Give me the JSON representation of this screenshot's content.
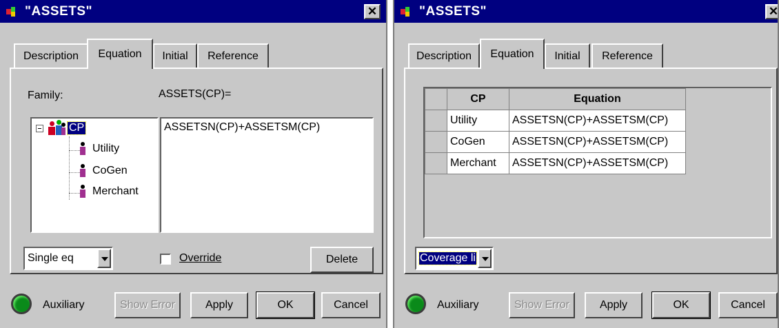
{
  "dialogs": [
    {
      "title": "\"ASSETS\"",
      "tabs": [
        "Description",
        "Equation",
        "Initial",
        "Reference"
      ],
      "active_tab": "Equation",
      "family_label": "Family:",
      "equation_label": "ASSETS(CP)=",
      "tree": {
        "root": "CP",
        "children": [
          "Utility",
          "CoGen",
          "Merchant"
        ]
      },
      "equation_text": "ASSETSN(CP)+ASSETSM(CP)",
      "mode_select": "Single eq",
      "override_label": "Override",
      "override_checked": false,
      "delete_label": "Delete",
      "status_label": "Auxiliary",
      "buttons": {
        "show_error": "Show Error",
        "apply": "Apply",
        "ok": "OK",
        "cancel": "Cancel"
      }
    },
    {
      "title": "\"ASSETS\"",
      "tabs": [
        "Description",
        "Equation",
        "Initial",
        "Reference"
      ],
      "active_tab": "Equation",
      "grid": {
        "headers": [
          "CP",
          "Equation"
        ],
        "rows": [
          [
            "Utility",
            "ASSETSN(CP)+ASSETSM(CP)"
          ],
          [
            "CoGen",
            "ASSETSN(CP)+ASSETSM(CP)"
          ],
          [
            "Merchant",
            "ASSETSN(CP)+ASSETSM(CP)"
          ]
        ]
      },
      "mode_select": "Coverage li",
      "status_label": "Auxiliary",
      "buttons": {
        "show_error": "Show Error",
        "apply": "Apply",
        "ok": "OK",
        "cancel": "Cancel"
      }
    }
  ]
}
